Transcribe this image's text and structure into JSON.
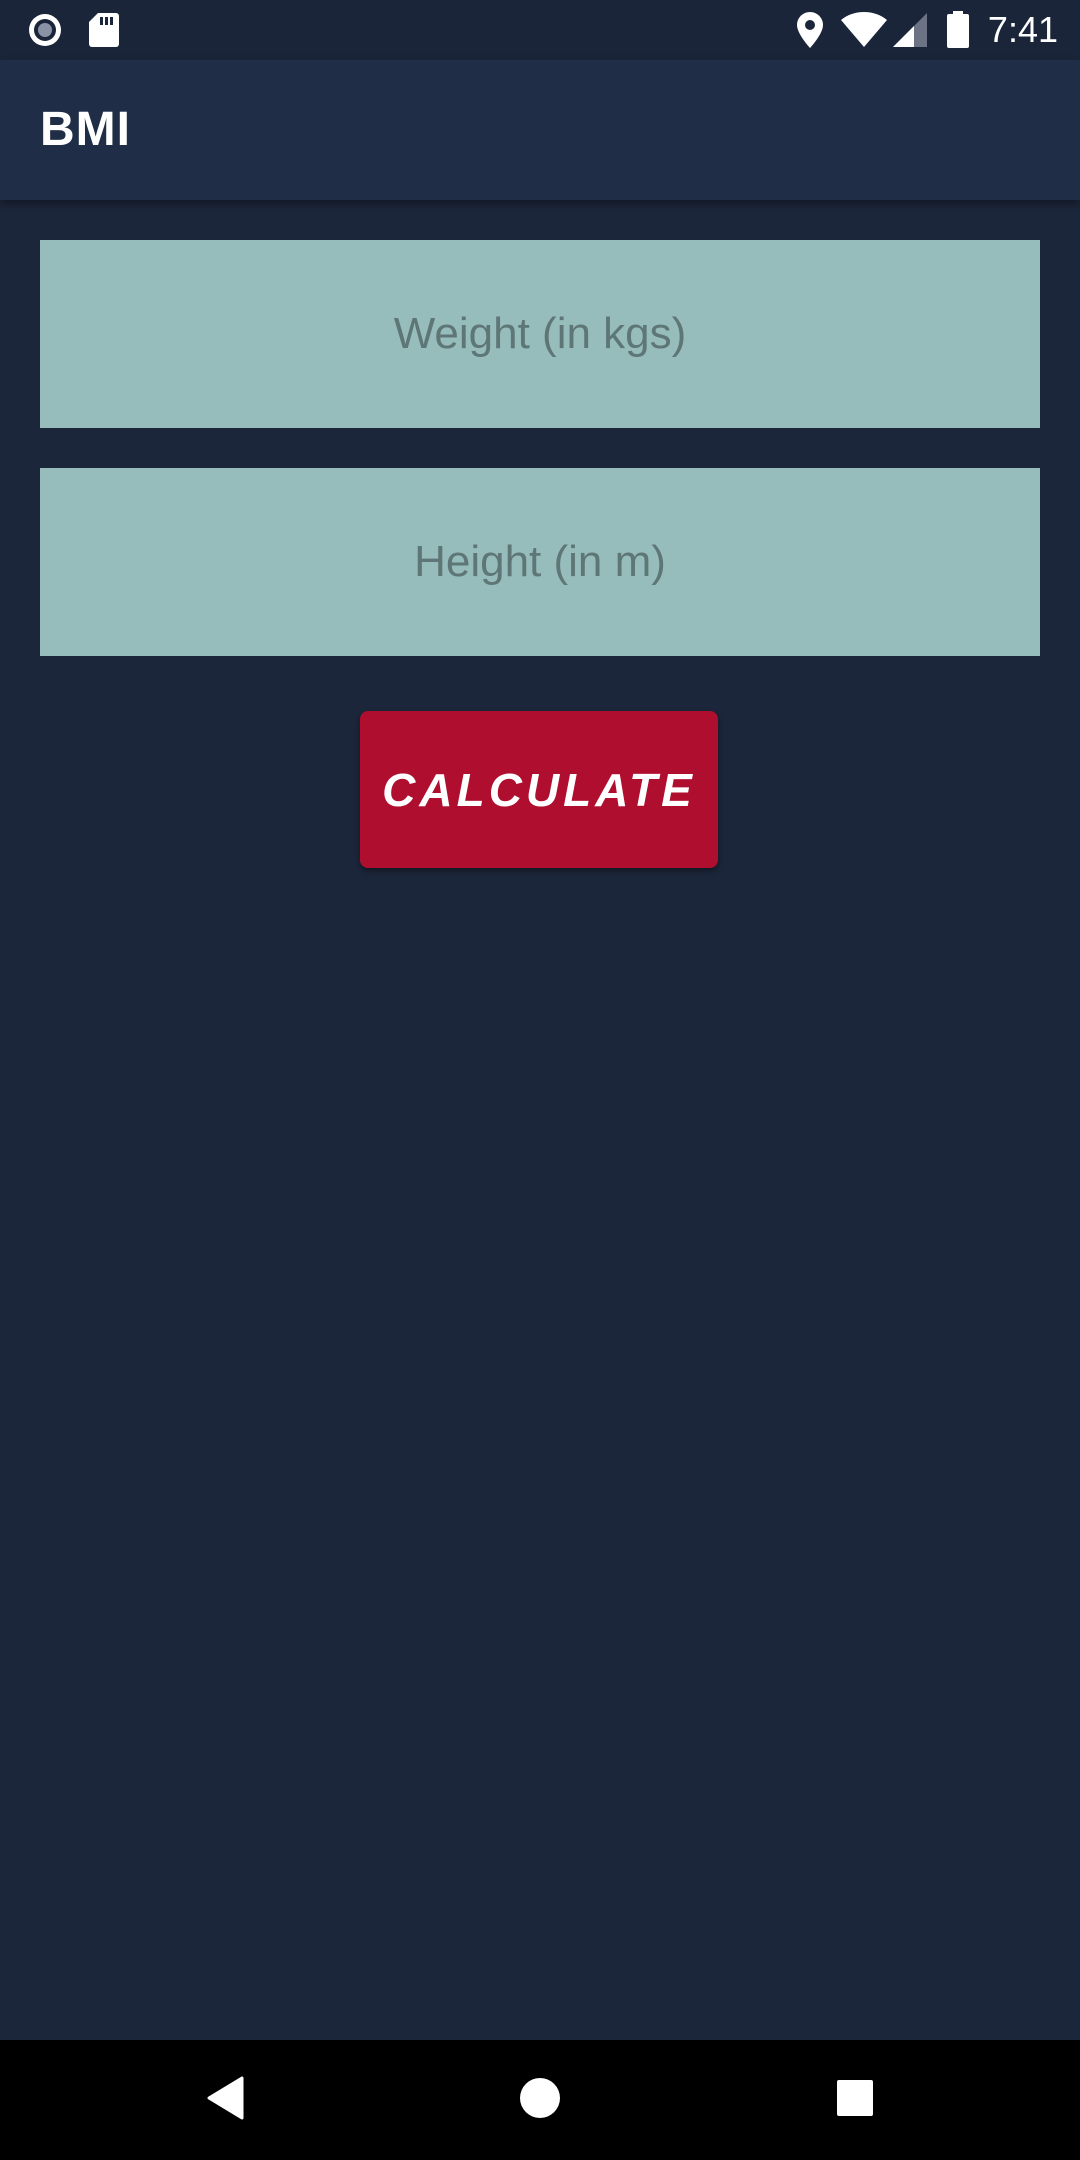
{
  "status_bar": {
    "time": "7:41",
    "icons": [
      "record-icon",
      "sd-card-icon",
      "location-icon",
      "wifi-icon",
      "signal-icon",
      "battery-icon"
    ]
  },
  "app_bar": {
    "title": "BMI"
  },
  "form": {
    "weight": {
      "placeholder": "Weight (in kgs)",
      "value": ""
    },
    "height": {
      "placeholder": "Height (in m)",
      "value": ""
    },
    "calculate_label": "CALCULATE"
  },
  "nav_bar": {
    "buttons": [
      "back-icon",
      "home-icon",
      "recents-icon"
    ]
  },
  "colors": {
    "background": "#1c263a",
    "app_bar": "#202d46",
    "field_bg": "#96bdbc",
    "field_text": "#5e7776",
    "button": "#b00e2f"
  }
}
